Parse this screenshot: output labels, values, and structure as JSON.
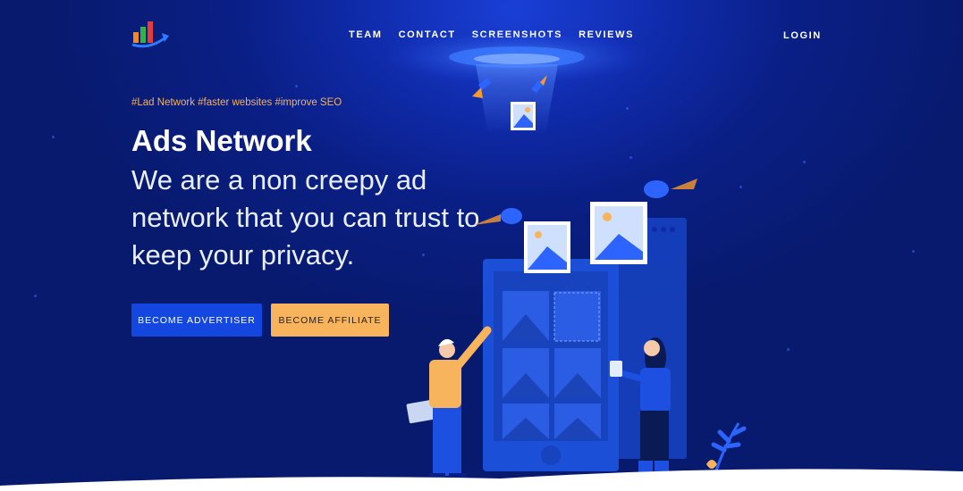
{
  "header": {
    "logo_icon": "bar-chart-logo-icon",
    "nav": [
      {
        "label": "TEAM"
      },
      {
        "label": "CONTACT"
      },
      {
        "label": "SCREENSHOTS"
      },
      {
        "label": "REVIEWS"
      }
    ],
    "login_label": "LOGIN"
  },
  "hero": {
    "tags": "#Lad Network #faster websites #improve SEO",
    "title": "Ads Network",
    "subtitle": "We are a non creepy ad network that you can trust to keep your privacy.",
    "advertiser_button": "BECOME ADVERTISER",
    "affiliate_button": "BECOME AFFILIATE"
  },
  "colors": {
    "background": "#0a1f86",
    "accent_blue": "#1446e0",
    "accent_orange": "#f8b45c",
    "tag_color": "#f5b25a"
  }
}
